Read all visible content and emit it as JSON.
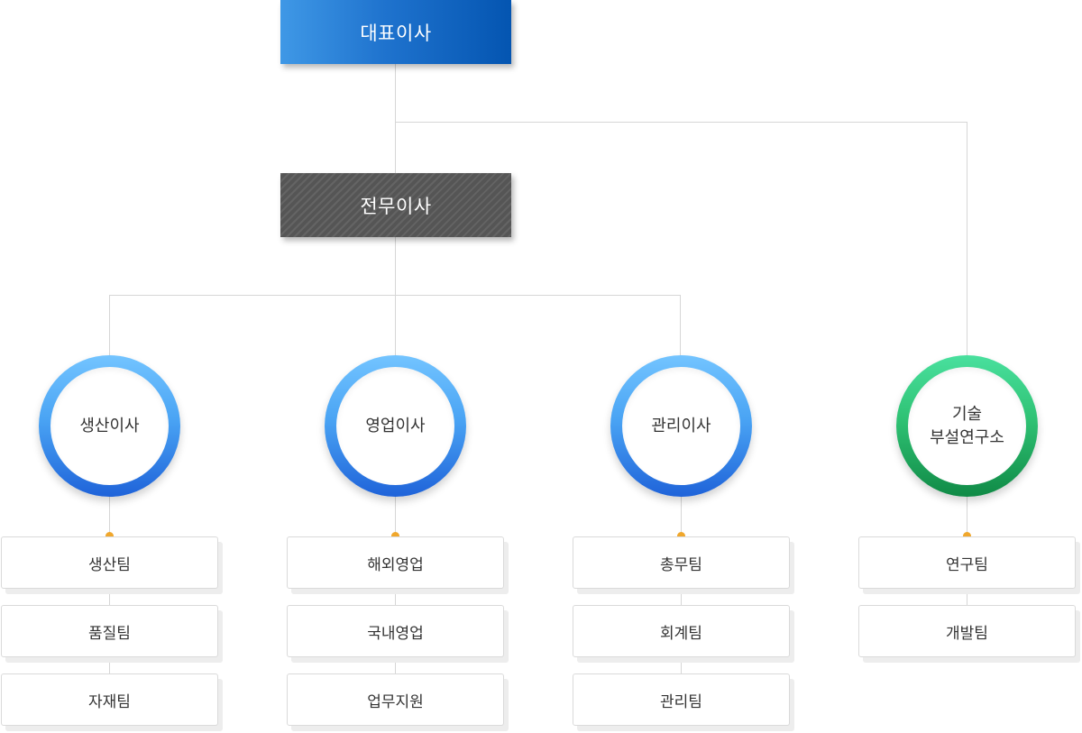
{
  "chart_data": {
    "type": "org-chart",
    "root": {
      "label": "대표이사",
      "children": [
        {
          "label": "전무이사",
          "children": [
            {
              "label": "생산이사",
              "teams": [
                "생산팀",
                "품질팀",
                "자재팀"
              ]
            },
            {
              "label": "영업이사",
              "teams": [
                "해외영업",
                "국내영업",
                "업무지원"
              ]
            },
            {
              "label": "관리이사",
              "teams": [
                "총무팀",
                "회계팀",
                "관리팀"
              ]
            }
          ]
        },
        {
          "label": "기술\n부설연구소",
          "teams": [
            "연구팀",
            "개발팀"
          ]
        }
      ]
    },
    "colors": {
      "ceo": "#1f73ce",
      "director": "#555555",
      "division_ring": "#4aa4f4",
      "lab_ring": "#2fc274",
      "connector": "#d6d6d6",
      "dot": "#f0a72c"
    }
  },
  "ceo": {
    "label": "대표이사"
  },
  "director": {
    "label": "전무이사"
  },
  "divisions": [
    {
      "label": "생산이사",
      "teams": [
        "생산팀",
        "품질팀",
        "자재팀"
      ]
    },
    {
      "label": "영업이사",
      "teams": [
        "해외영업",
        "국내영업",
        "업무지원"
      ]
    },
    {
      "label": "관리이사",
      "teams": [
        "총무팀",
        "회계팀",
        "관리팀"
      ]
    },
    {
      "label": "기술\n부설연구소",
      "teams": [
        "연구팀",
        "개발팀"
      ]
    }
  ]
}
